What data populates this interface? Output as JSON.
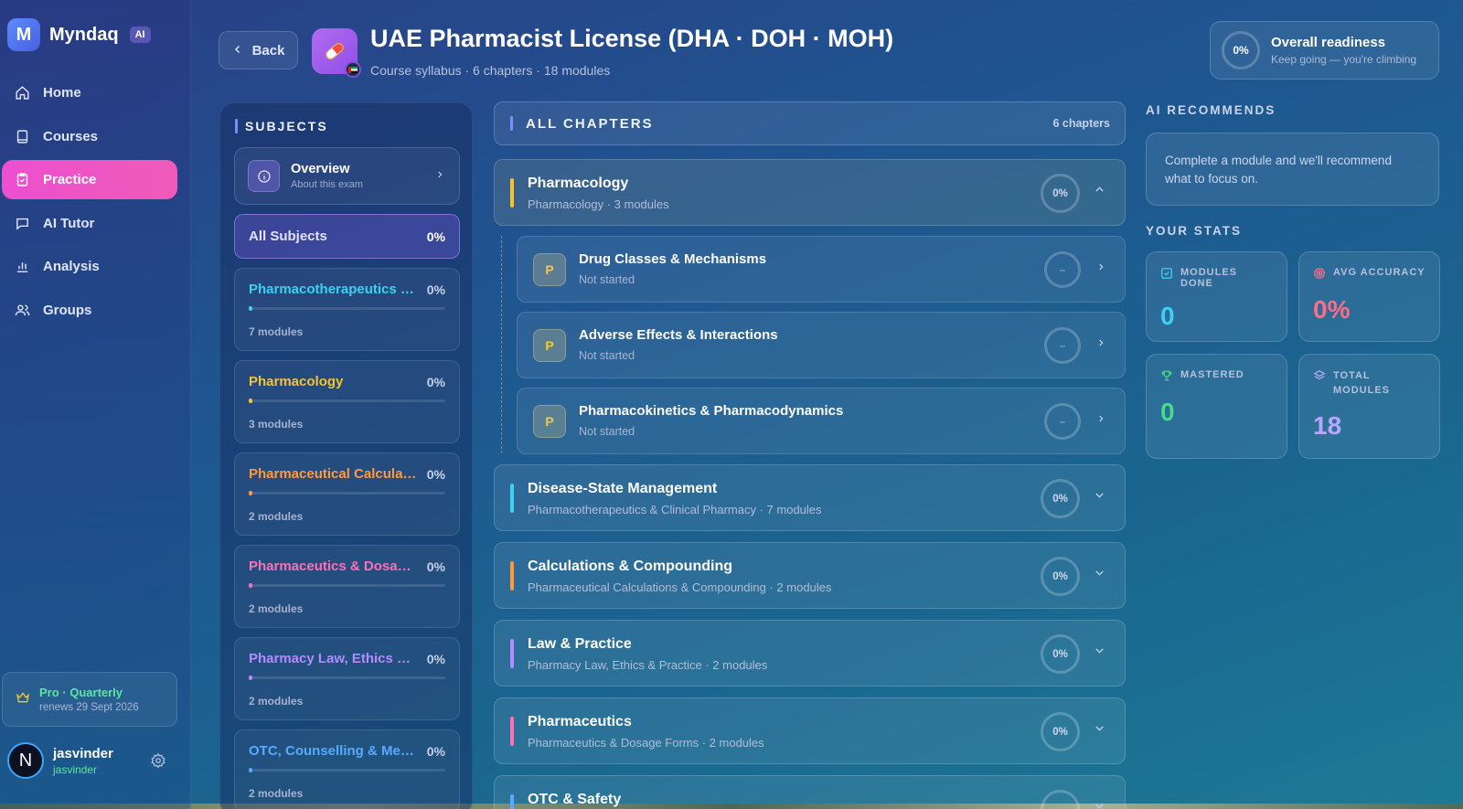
{
  "brand": {
    "name": "Myndaq",
    "badge": "AI",
    "logo_letter": "M"
  },
  "nav": [
    {
      "label": "Home",
      "icon": "home-icon",
      "active": false
    },
    {
      "label": "Courses",
      "icon": "book-icon",
      "active": false
    },
    {
      "label": "Practice",
      "icon": "clipboard-icon",
      "active": true
    },
    {
      "label": "AI Tutor",
      "icon": "chat-icon",
      "active": false
    },
    {
      "label": "Analysis",
      "icon": "bar-chart-icon",
      "active": false
    },
    {
      "label": "Groups",
      "icon": "users-icon",
      "active": false
    }
  ],
  "plan": {
    "title": "Pro · Quarterly",
    "renews": "renews 29 Sept 2026"
  },
  "user": {
    "name": "jasvinder",
    "handle": "jasvinder",
    "initial": "N"
  },
  "header": {
    "back_label": "Back",
    "title": "UAE Pharmacist License (DHA · DOH · MOH)",
    "subtitle": "Course syllabus · 6 chapters · 18 modules"
  },
  "readiness": {
    "value": "0%",
    "title": "Overall readiness",
    "subtitle": "Keep going — you're climbing"
  },
  "subjects": {
    "title": "SUBJECTS",
    "overview": {
      "title": "Overview",
      "subtitle": "About this exam"
    },
    "all": {
      "label": "All Subjects",
      "pct": "0%"
    },
    "items": [
      {
        "name": "Pharmacotherapeutics & Clinical Pharmacy",
        "pct": "0%",
        "modules": "7 modules",
        "color": "#3ed0f0"
      },
      {
        "name": "Pharmacology",
        "pct": "0%",
        "modules": "3 modules",
        "color": "#f5c330"
      },
      {
        "name": "Pharmaceutical Calculations & Compounding",
        "pct": "0%",
        "modules": "2 modules",
        "color": "#ff9a3c"
      },
      {
        "name": "Pharmaceutics & Dosage Forms",
        "pct": "0%",
        "modules": "2 modules",
        "color": "#ff6fb5"
      },
      {
        "name": "Pharmacy Law, Ethics & Practice",
        "pct": "0%",
        "modules": "2 modules",
        "color": "#b28bff"
      },
      {
        "name": "OTC, Counselling & Medication Safety",
        "pct": "0%",
        "modules": "2 modules",
        "color": "#5aa8ff"
      }
    ]
  },
  "chapters": {
    "title": "ALL CHAPTERS",
    "count": "6 chapters",
    "items": [
      {
        "title": "Pharmacology",
        "subtitle": "Pharmacology · 3 modules",
        "pct": "0%",
        "color": "#f5c330"
      },
      {
        "title": "Disease-State Management",
        "subtitle": "Pharmacotherapeutics & Clinical Pharmacy · 7 modules",
        "pct": "0%",
        "color": "#3ed0f0"
      },
      {
        "title": "Calculations & Compounding",
        "subtitle": "Pharmaceutical Calculations & Compounding · 2 modules",
        "pct": "0%",
        "color": "#ff9a3c"
      },
      {
        "title": "Law & Practice",
        "subtitle": "Pharmacy Law, Ethics & Practice · 2 modules",
        "pct": "0%",
        "color": "#b28bff"
      },
      {
        "title": "Pharmaceutics",
        "subtitle": "Pharmaceutics & Dosage Forms · 2 modules",
        "pct": "0%",
        "color": "#ff6fb5"
      },
      {
        "title": "OTC & Safety",
        "subtitle": "",
        "pct": "",
        "color": "#5aa8ff"
      }
    ],
    "modules": [
      {
        "badge": "P",
        "title": "Drug Classes & Mechanisms",
        "status": "Not started",
        "progress": "–"
      },
      {
        "badge": "P",
        "title": "Adverse Effects & Interactions",
        "status": "Not started",
        "progress": "–"
      },
      {
        "badge": "P",
        "title": "Pharmacokinetics & Pharmacodynamics",
        "status": "Not started",
        "progress": "–"
      }
    ]
  },
  "ai": {
    "title": "AI RECOMMENDS",
    "text": "Complete a module and we'll recommend what to focus on."
  },
  "stats": {
    "title": "YOUR STATS",
    "modules_done": {
      "label": "MODULES DONE",
      "value": "0",
      "color": "#3ed0f0"
    },
    "avg_accuracy": {
      "label": "AVG ACCURACY",
      "value": "0%",
      "color": "#ff6b8a"
    },
    "mastered": {
      "label": "MASTERED",
      "value": "0",
      "color": "#48d98a"
    },
    "total_modules": {
      "label": "TOTAL MODULES",
      "value": "18",
      "color": "#b9a6ff"
    }
  }
}
